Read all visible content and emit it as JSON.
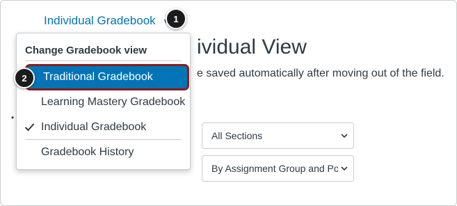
{
  "header": {
    "gradebook_toggle_label": "Individual Gradebook",
    "page_title": "ividual View",
    "page_subtitle": "e saved automatically after moving out of the field."
  },
  "steps": {
    "step1": "1",
    "step2": "2"
  },
  "gradebook_menu": {
    "header": "Change Gradebook view",
    "items": [
      {
        "label": "Traditional Gradebook",
        "highlighted": true
      },
      {
        "label": "Learning Mastery Gradebook"
      },
      {
        "label": "Individual Gradebook",
        "checked": true
      },
      {
        "label": "Gradebook History"
      }
    ]
  },
  "filters": {
    "section_select": "All Sections",
    "sort_select": "By Assignment Group and Pos"
  },
  "colors": {
    "link": "#0374b5",
    "highlight_bg": "#0374b5",
    "highlight_outline": "#8b1d1d",
    "badge": "#1b1b1b"
  }
}
